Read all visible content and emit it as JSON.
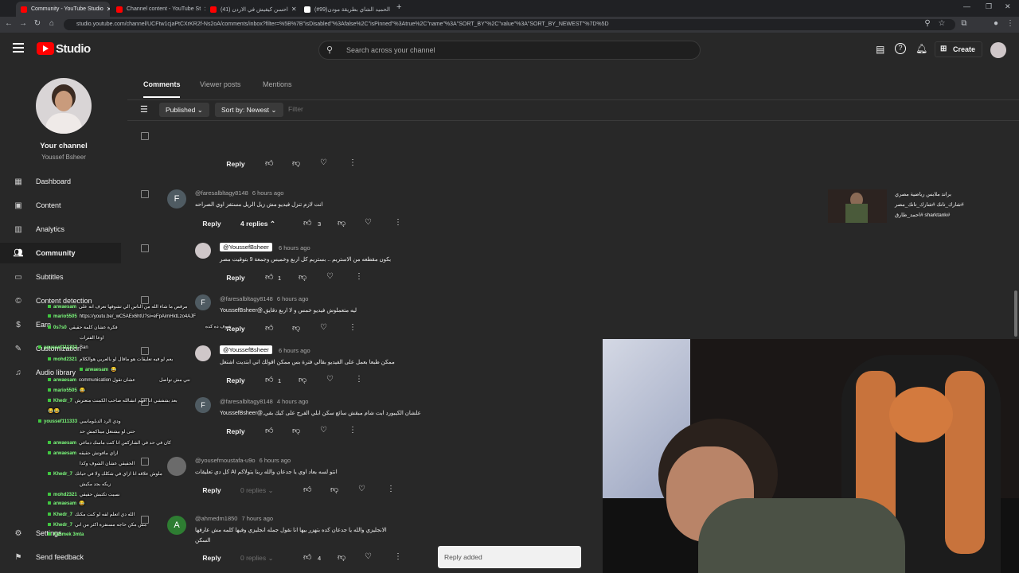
{
  "browser": {
    "tabs": [
      {
        "label": "Community - YouTube Studio",
        "active": true,
        "color": "#ff0000"
      },
      {
        "label": "Channel content - YouTube St",
        "active": false,
        "color": "#ff0000"
      },
      {
        "label": "(41) احسن كيفيش في الاردن",
        "active": false,
        "color": "#ff0000"
      },
      {
        "label": "(#99)الحميد الشاي بطريقة مودن",
        "active": false,
        "color": "#ffffff"
      }
    ],
    "url": "studio.youtube.com/channel/UCFtw1cjaPtCXrKR2f-Ns2oA/comments/inbox?filter=%5B%7B\"isDisabled\"%3Afalse%2C\"isPinned\"%3Atrue%2C\"name\"%3A\"SORT_BY\"%2C\"value\"%3A\"SORT_BY_NEWEST\"%7D%5D"
  },
  "header": {
    "logo": "Studio",
    "search_placeholder": "Search across your channel",
    "create_label": "Create"
  },
  "sidebar": {
    "channel_title": "Your channel",
    "channel_name": "Youssef Bsheer",
    "items": [
      {
        "label": "Dashboard",
        "icon": "dashboard-icon"
      },
      {
        "label": "Content",
        "icon": "content-icon"
      },
      {
        "label": "Analytics",
        "icon": "analytics-icon"
      },
      {
        "label": "Community",
        "icon": "community-icon",
        "active": true
      },
      {
        "label": "Subtitles",
        "icon": "subtitles-icon"
      },
      {
        "label": "Content detection",
        "icon": "copyright-icon"
      },
      {
        "label": "Earn",
        "icon": "earn-icon"
      },
      {
        "label": "Customization",
        "icon": "customization-icon"
      },
      {
        "label": "Audio library",
        "icon": "audio-library-icon"
      }
    ],
    "settings_label": "Settings",
    "feedback_label": "Send feedback"
  },
  "tabs": [
    "Comments",
    "Viewer posts",
    "Mentions"
  ],
  "filters": {
    "published": "Published",
    "sort": "Sort by: Newest",
    "filter_placeholder": "Filter"
  },
  "comments": [
    {
      "id": "c0",
      "reply_label": "Reply"
    },
    {
      "id": "c1",
      "handle": "@faresalbltagy8148",
      "ago": "6 hours ago",
      "text": "انت لازم تنزل فيديو مش زيل الريل مستفز اوي الصراحه",
      "reply_label": "Reply",
      "replies_label": "4 replies",
      "likes": "3"
    },
    {
      "id": "c2",
      "handle": "@YoussefBsheer",
      "ago": "6 hours ago",
      "text": "بكون مقطعه من الاستريم .. بستريم كل اربع وخميس وجمعة 9 بتوقيت مصر",
      "reply_label": "Reply",
      "likes": "1"
    },
    {
      "id": "c3",
      "handle": "@faresalbltagy8148",
      "ago": "6 hours ago",
      "text": "ليه متعملوش فيديو خمس و لا اربع دقايق,@YoussefBsheer",
      "reply_label": "Reply"
    },
    {
      "id": "c4",
      "handle": "@YoussefBsheer",
      "ago": "6 hours ago",
      "text": "ممكن طبعا بعمل على الفيديو بقالي فترة بس ممكن اقولك اني ابتديت اشتغل",
      "reply_label": "Reply",
      "likes": "1"
    },
    {
      "id": "c5",
      "handle": "@faresalbltagy8148",
      "ago": "4 hours ago",
      "text": "علشان الكيبورد ابت شام مبقش سائع سكن ابلي الفرج على كيك بقي,@YoussefBsheer",
      "reply_label": "Reply"
    },
    {
      "id": "c6",
      "handle": "@yousefmoustafa-u9o",
      "ago": "6 hours ago",
      "text": "انتو لسه بعاد اوي يا جدعان والله ربنا يتولاكم AI كل دي تعليقات",
      "reply_label": "Reply",
      "replies_label": "0 replies"
    },
    {
      "id": "c7",
      "handle": "@ahmedm1850",
      "ago": "7 hours ago",
      "text": "الانجليزي والله يا جدعان كده بتهزر بيها انا نقول جمله انجليزي وفيها كلمه مش عارفها",
      "text2": "السكن",
      "reply_label": "Reply",
      "replies_label": "0 replies",
      "likes": "4"
    }
  ],
  "promo": {
    "line1": "براند ملابس رياضية مصري",
    "line2": "#شارك_تانك #شارك_تانك_مصر",
    "line3": "#sharktank #احمد_طارق"
  },
  "chat": [
    {
      "user": "arwaesam",
      "msg": "مرقص ما شاء الله من الناس الي تشوفها تعرف انه على"
    },
    {
      "user": "mario5505",
      "msg": "https://youtu.be/_wC5AEx6htU?si=eFpAimHktLzo4AJF"
    },
    {
      "user": "",
      "msg": "شوف ده كده"
    },
    {
      "user": "0s7s0",
      "msg": "فكرة عشان كلمة حقيقي"
    },
    {
      "user": "",
      "msg": "اوعا الفترات"
    },
    {
      "user": "youssef111333",
      "msg": "Ban"
    },
    {
      "user": "mohd2321",
      "msg": "يعم لو فيه تعليقات هو ماقال لو بالعربي هوالكلام"
    },
    {
      "user": "arwaesam",
      "msg": "😂"
    },
    {
      "user": "mario5505",
      "msg": "😂"
    },
    {
      "user": "arwaesam",
      "msg": "communication عشان تقول"
    },
    {
      "user": "",
      "msg": "نتي مش تواصل"
    },
    {
      "user": "Khedr_7",
      "msg": "بعد بشفشي انا افهم انشالله صاحب الكمنت متعترش"
    },
    {
      "user": "",
      "msg": "😂😂"
    },
    {
      "user": "youssef111333",
      "msg": "ودي الرد الدبلوماسي"
    },
    {
      "user": "",
      "msg": "حتى لو بيشتغل ميتاكمش حد"
    },
    {
      "user": "arwaesam",
      "msg": "كان في حد في الشاركس انا كنت ماسك دماغي"
    },
    {
      "user": "arwaesam",
      "msg": "ازاي مافوتش حقيقه"
    },
    {
      "user": "",
      "msg": "الحقيقي عشان الشوف وكدا"
    },
    {
      "user": "Khedr_7",
      "msg": "ملوش علاقه انا ازاي في شكلك ولا في حياتك"
    },
    {
      "user": "",
      "msg": "زيكه بجد مكيش"
    },
    {
      "user": "mohd2321",
      "msg": "نسيت تكتبش حقيقي"
    },
    {
      "user": "arwaesam",
      "msg": "😂"
    },
    {
      "user": "Khedr_7",
      "msg": "الله دي اتعلم لفه لو كنت مكنك"
    },
    {
      "user": "Khedr_7",
      "msg": "مش مكن حاجه مستفزة اكثر من اني"
    },
    {
      "user": "Fahmek 3mta",
      "msg": ""
    }
  ],
  "toast": "Reply added",
  "colors": {
    "brand_red": "#ff0000",
    "background": "#282828",
    "chat_user": "#7cfc7c"
  }
}
